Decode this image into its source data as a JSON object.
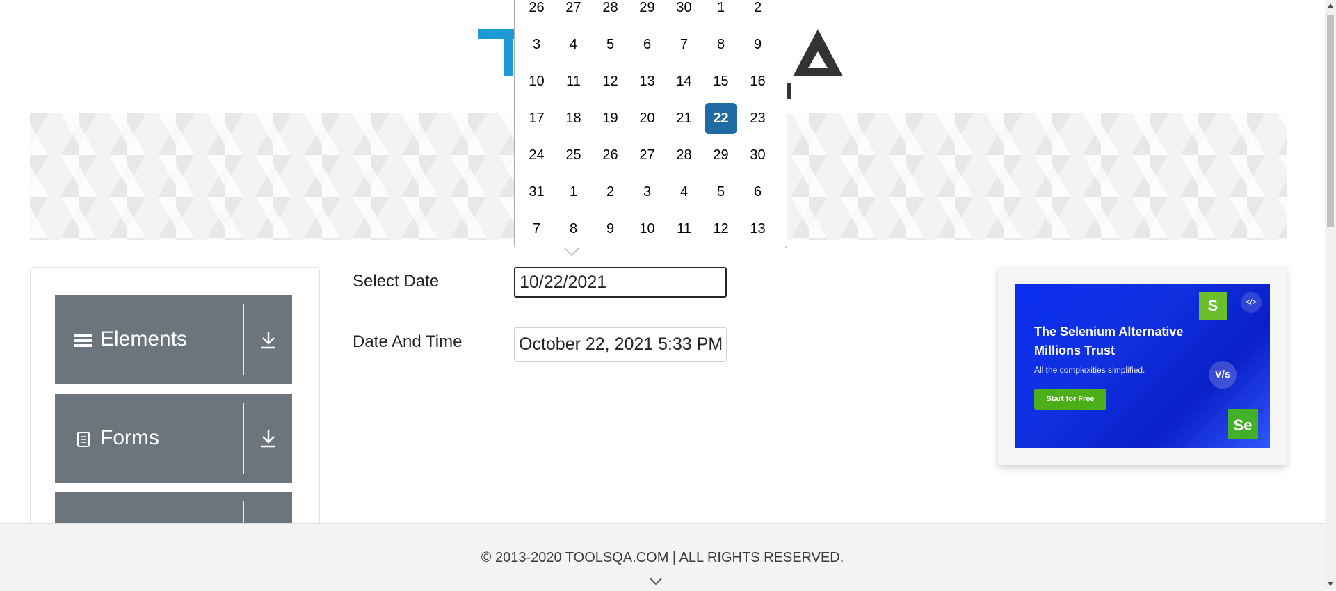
{
  "logo": {
    "alt": "TOOLSQA"
  },
  "sidebar": {
    "groups": [
      {
        "label": "Elements",
        "icon": "menu-icon"
      },
      {
        "label": "Forms",
        "icon": "document-icon"
      },
      {
        "label": "",
        "icon": ""
      }
    ]
  },
  "form": {
    "select_date_label": "Select Date",
    "select_date_value": "10/22/2021",
    "date_time_label": "Date And Time",
    "date_time_value": "October 22, 2021 5:33 PM"
  },
  "calendar": {
    "weeks": [
      [
        "26",
        "27",
        "28",
        "29",
        "30",
        "1",
        "2"
      ],
      [
        "3",
        "4",
        "5",
        "6",
        "7",
        "8",
        "9"
      ],
      [
        "10",
        "11",
        "12",
        "13",
        "14",
        "15",
        "16"
      ],
      [
        "17",
        "18",
        "19",
        "20",
        "21",
        "22",
        "23"
      ],
      [
        "24",
        "25",
        "26",
        "27",
        "28",
        "29",
        "30"
      ],
      [
        "31",
        "1",
        "2",
        "3",
        "4",
        "5",
        "6"
      ],
      [
        "7",
        "8",
        "9",
        "10",
        "11",
        "12",
        "13"
      ]
    ],
    "selected": "22",
    "selected_color": "#216ba5"
  },
  "ad": {
    "title": "The Selenium Alternative Millions Trust",
    "subtitle": "All the complexities simplified.",
    "cta": "Start for Free",
    "badge_s": "S",
    "badge_vs": "V/s",
    "badge_se": "Se",
    "code_icon": "</>"
  },
  "footer": {
    "copyright": "© 2013-2020 TOOLSQA.COM | ALL RIGHTS RESERVED."
  },
  "colors": {
    "sidebar_group": "#6c757d",
    "accent": "#1b9ad6"
  }
}
